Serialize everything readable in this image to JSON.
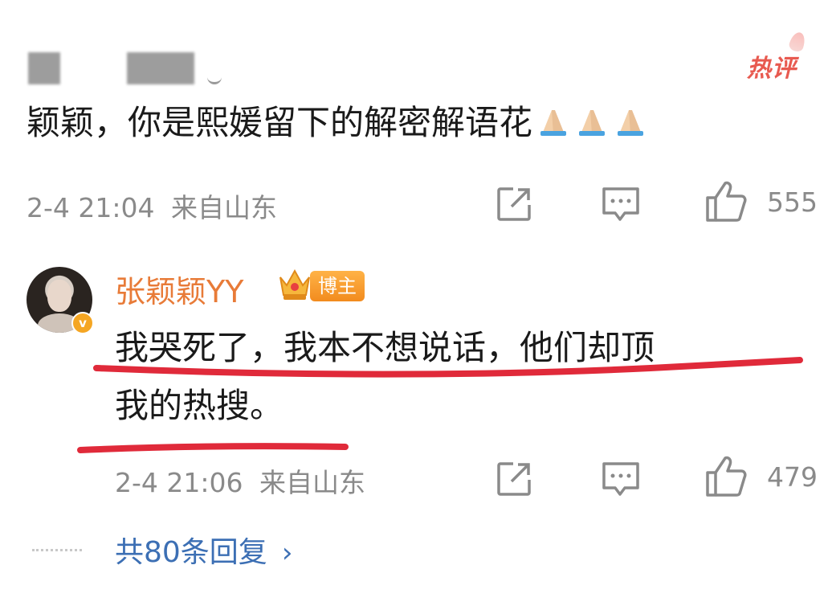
{
  "comment": {
    "hot_badge": "热评",
    "text": "颖颖，你是熙媛留下的解密解语花",
    "emoji_count": 3,
    "emoji_name": "pray-emoji",
    "time": "2-4 21:04",
    "location": "来自山东",
    "likes": "555"
  },
  "reply": {
    "username": "张颖颖YY",
    "badge": "博主",
    "text_line1": "我哭死了，我本不想说话，他们却顶",
    "text_line2": "我的热搜。",
    "time": "2-4 21:06",
    "location": "来自山东",
    "likes": "479"
  },
  "more_replies": "共80条回复",
  "colors": {
    "username": "#e87b38",
    "link": "#3c6fb4",
    "underline": "#e02a3a",
    "meta": "#8a8a8a"
  },
  "icons": [
    "share-icon",
    "comment-icon",
    "like-icon",
    "crown-icon",
    "verified-icon",
    "chevron-right-icon"
  ]
}
